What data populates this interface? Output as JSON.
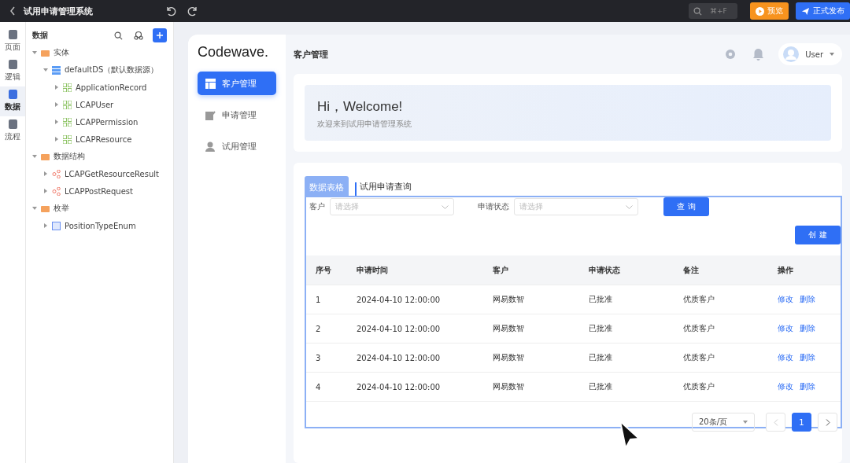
{
  "topbar": {
    "title": "试用申请管理系统",
    "search_hint": "⌘+F",
    "preview": "预览",
    "publish": "正式发布"
  },
  "rail": [
    {
      "label": "页面",
      "selected": false
    },
    {
      "label": "逻辑",
      "selected": false
    },
    {
      "label": "数据",
      "selected": true
    },
    {
      "label": "流程",
      "selected": false
    }
  ],
  "tree": {
    "title": "数据",
    "items": [
      {
        "label": "实体",
        "kind": "folder",
        "expanded": true,
        "children": [
          {
            "label": "defaultDS（默认数据源）",
            "kind": "datasource",
            "expanded": true,
            "children": [
              {
                "label": "ApplicationRecord",
                "kind": "entity",
                "expanded": false
              },
              {
                "label": "LCAPUser",
                "kind": "entity",
                "expanded": false
              },
              {
                "label": "LCAPPermission",
                "kind": "entity",
                "expanded": false
              },
              {
                "label": "LCAPResource",
                "kind": "entity",
                "expanded": false
              }
            ]
          }
        ]
      },
      {
        "label": "数据结构",
        "kind": "folder",
        "expanded": true,
        "children": [
          {
            "label": "LCAPGetResourceResult",
            "kind": "struct",
            "expanded": false
          },
          {
            "label": "LCAPPostRequest",
            "kind": "struct",
            "expanded": false
          }
        ]
      },
      {
        "label": "枚举",
        "kind": "folder",
        "expanded": true,
        "children": [
          {
            "label": "PositionTypeEnum",
            "kind": "enum",
            "expanded": false
          }
        ]
      }
    ]
  },
  "app": {
    "logo": "Codewave.",
    "nav": [
      {
        "label": "客户管理",
        "kind": "table",
        "selected": true
      },
      {
        "label": "申请管理",
        "kind": "edit",
        "selected": false
      },
      {
        "label": "试用管理",
        "kind": "user",
        "selected": false
      }
    ],
    "header": {
      "title": "客户管理",
      "user": "User"
    },
    "welcome": {
      "title": "Hi，Welcome!",
      "subtitle": "欢迎来到试用申请管理系统"
    },
    "panel": {
      "tag": "数据表格",
      "title": "试用申请查询",
      "filters": [
        {
          "label": "客户",
          "placeholder": "请选择"
        },
        {
          "label": "申请状态",
          "placeholder": "请选择"
        }
      ],
      "query": "查 询",
      "create": "创 建",
      "columns": [
        "序号",
        "申请时间",
        "客户",
        "申请状态",
        "备注",
        "操作"
      ],
      "rows": [
        {
          "cells": [
            "1",
            "2024-04-10 12:00:00",
            "网易数智",
            "已批准",
            "优质客户"
          ],
          "actions": [
            "修改",
            "删除"
          ]
        },
        {
          "cells": [
            "2",
            "2024-04-10 12:00:00",
            "网易数智",
            "已批准",
            "优质客户"
          ],
          "actions": [
            "修改",
            "删除"
          ]
        },
        {
          "cells": [
            "3",
            "2024-04-10 12:00:00",
            "网易数智",
            "已批准",
            "优质客户"
          ],
          "actions": [
            "修改",
            "删除"
          ]
        },
        {
          "cells": [
            "4",
            "2024-04-10 12:00:00",
            "网易数智",
            "已批准",
            "优质客户"
          ],
          "actions": [
            "修改",
            "删除"
          ]
        }
      ],
      "page_size": "20条/页",
      "pages": [
        {
          "label": "1",
          "selected": true
        }
      ]
    }
  }
}
